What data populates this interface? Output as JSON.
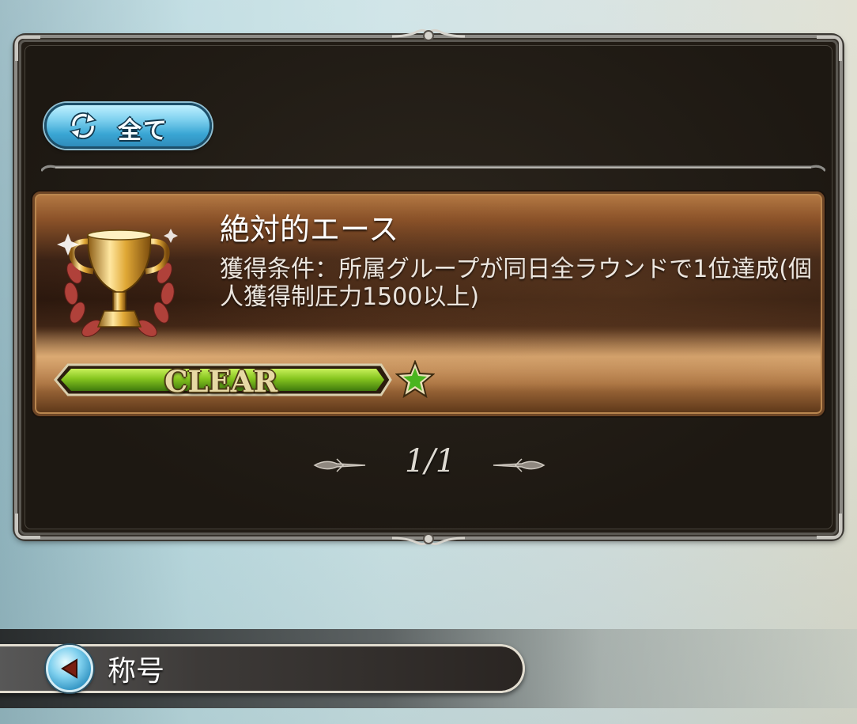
{
  "filter": {
    "label": "全て",
    "icon": "refresh-icon"
  },
  "title_entry": {
    "name": "絶対的エース",
    "condition": "獲得条件：所属グループが同日全ラウンドで1位達成(個人獲得制圧力1500以上)",
    "status": "CLEAR",
    "progress_fraction": 1.0,
    "icon": "trophy-icon",
    "rank_icon": "green-star-icon"
  },
  "pagination": {
    "indicator": "1/1"
  },
  "nav": {
    "title": "称号",
    "back_icon": "back-arrow-icon"
  },
  "colors": {
    "frame_dark": "#221c15",
    "card_bronze": "#b57a44",
    "clear_green": "#7dbb1e",
    "button_blue": "#3aa6d4"
  }
}
